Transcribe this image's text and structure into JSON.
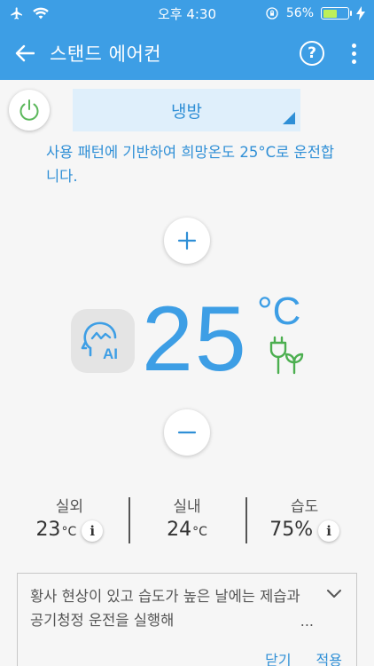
{
  "status_bar": {
    "time": "오후 4:30",
    "battery": "56%",
    "battery_level": 0.56
  },
  "app_bar": {
    "title": "스탠드 에어컨",
    "help_label": "?"
  },
  "mode": {
    "selected": "냉방"
  },
  "info_text": "사용 패턴에 기반하여 희망온도 25°C로 운전합니다.",
  "temperature": {
    "value": "25",
    "unit": "°C",
    "ai_label": "AI"
  },
  "stats": [
    {
      "label": "실외",
      "value": "23",
      "unit": "°C",
      "has_info": true
    },
    {
      "label": "실내",
      "value": "24",
      "unit": "°C",
      "has_info": false
    },
    {
      "label": "습도",
      "value": "75%",
      "unit": "",
      "has_info": true
    }
  ],
  "info_glyph": "i",
  "tip": {
    "text": "황사 현상이 있고 습도가 높은 날에는 제습과 공기청정 운전을 실행해",
    "ellipsis": "...",
    "close_label": "닫기",
    "apply_label": "적용"
  },
  "colors": {
    "primary": "#3d9ee5",
    "accent_text": "#2f8fd6",
    "power_green": "#5cb85c",
    "eco_green": "#4caf50"
  }
}
